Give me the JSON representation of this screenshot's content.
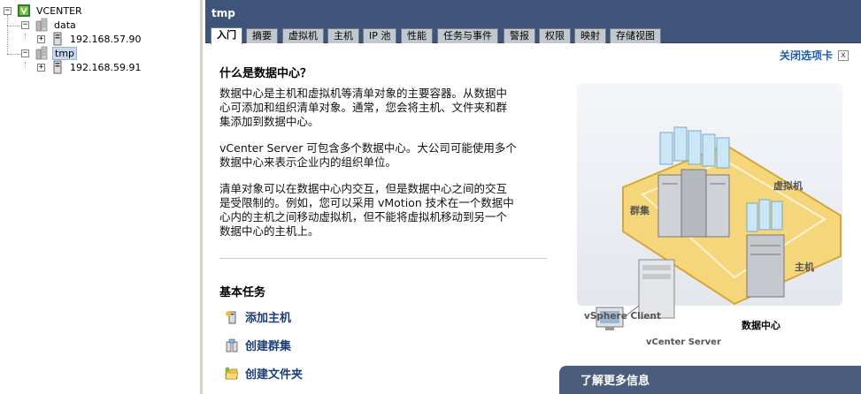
{
  "tree": {
    "root_label": "VCENTER",
    "datacenters": [
      {
        "label": "data",
        "hosts": [
          "192.168.57.90"
        ]
      },
      {
        "label": "tmp",
        "hosts": [
          "192.168.59.91"
        ]
      }
    ]
  },
  "panel": {
    "title": "tmp",
    "tabs": [
      "入门",
      "摘要",
      "虚拟机",
      "主机",
      "IP 池",
      "性能",
      "任务与事件",
      "警报",
      "权限",
      "映射",
      "存储视图"
    ],
    "active_tab": "入门",
    "close_tab_label": "关闭选项卡",
    "close_x": "x"
  },
  "content": {
    "heading": "什么是数据中心？",
    "paragraphs": [
      [
        "数据中心是主机和虚拟机等清单对象的主要容器。从数据中",
        "心可添加和组织清单对象。通常，您会将主机、文件夹和群",
        "集添加到数据中心。"
      ],
      [
        "vCenter Server 可包含多个数据中心。大公司可能使用多个",
        "数据中心来表示企业内的组织单位。"
      ],
      [
        "清单对象可以在数据中心内交互，但是数据中心之间的交互",
        "是受限制的。例如，您可以采用 vMotion 技术在一个数据中",
        "心内的主机之间移动虚拟机，但不能将虚拟机移动到另一个",
        "数据中心的主机上。"
      ]
    ],
    "tasks_heading": "基本任务",
    "tasks": [
      {
        "label": "添加主机",
        "icon": "add-host-icon"
      },
      {
        "label": "创建群集",
        "icon": "create-cluster-icon"
      },
      {
        "label": "创建文件夹",
        "icon": "create-folder-icon"
      }
    ],
    "diagram_labels": {
      "vms": "虚拟机",
      "cluster": "群集",
      "host": "主机",
      "vcenter_server": "vCenter Server",
      "datacenter": "数据中心",
      "client": "vSphere Client"
    },
    "learn_more": "了解更多信息"
  },
  "colors": {
    "header_bg": "#3e5478",
    "link": "#1f5cad",
    "platform": "#f5d67a"
  }
}
